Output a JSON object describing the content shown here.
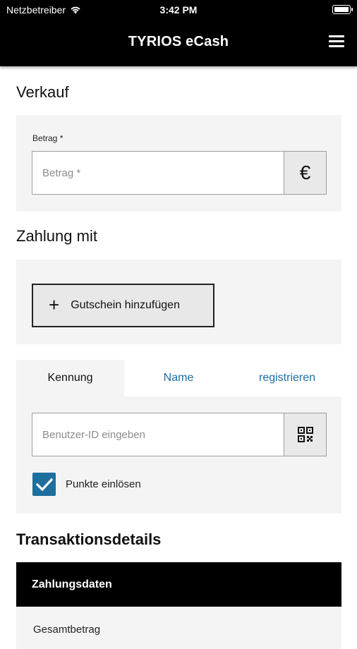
{
  "statusbar": {
    "carrier": "Netzbetreiber",
    "time": "3:42 PM"
  },
  "navbar": {
    "title": "TYRIOS eCash"
  },
  "verkauf": {
    "heading": "Verkauf",
    "amount_label": "Betrag *",
    "amount_placeholder": "Betrag *",
    "currency_symbol": "€"
  },
  "zahlung": {
    "heading": "Zahlung mit",
    "voucher_button_label": "Gutschein hinzufügen",
    "plus_symbol": "+"
  },
  "tabs": [
    {
      "label": "Kennung",
      "active": true
    },
    {
      "label": "Name",
      "active": false
    },
    {
      "label": "registrieren",
      "active": false
    }
  ],
  "identity": {
    "user_id_placeholder": "Benutzer-ID eingeben",
    "redeem_points_label": "Punkte einlösen",
    "redeem_points_checked": true
  },
  "transaktion": {
    "heading": "Transaktionsdetails",
    "table_header": "Zahlungsdaten",
    "rows": [
      {
        "label": "Gesamtbetrag"
      }
    ]
  },
  "colors": {
    "accent": "#1f6f9e",
    "link": "#1a6fa8",
    "bar": "#000000"
  }
}
